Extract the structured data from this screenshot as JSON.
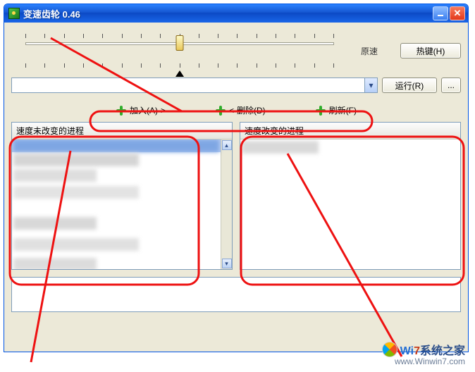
{
  "window": {
    "title": "变速齿轮 0.46"
  },
  "toolbar": {
    "speed_label": "原速",
    "hotkey_btn": "热键(H)",
    "run_btn": "运行(R)",
    "browse_btn": "...",
    "combo_value": ""
  },
  "actions": {
    "add": "加入(A)->",
    "remove": "<-删除(D)",
    "refresh": "刷新(F)"
  },
  "lists": {
    "left_header": "速度未改变的进程",
    "right_header": "速度改变的进程"
  },
  "watermark": {
    "brand_prefix": "Wi",
    "brand_accent": "7",
    "brand_suffix": "系统之家",
    "url": "www.Winwin7.com"
  }
}
